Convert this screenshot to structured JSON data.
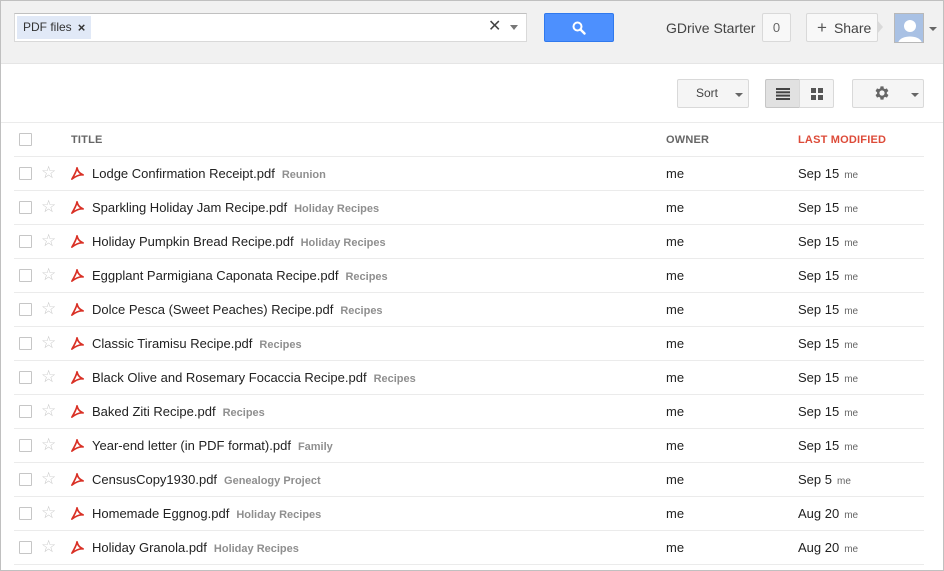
{
  "search": {
    "chip_label": "PDF files",
    "chip_remove": "×",
    "clear": "✕",
    "value": ""
  },
  "account": {
    "name": "GDrive Starter",
    "notifications": "0",
    "share_label": "Share",
    "share_plus": "+"
  },
  "toolbar": {
    "sort_label": "Sort"
  },
  "table": {
    "headers": {
      "title": "TITLE",
      "owner": "OWNER",
      "last_modified": "LAST MODIFIED"
    },
    "rows": [
      {
        "name": "Lodge Confirmation Receipt.pdf",
        "folder": "Reunion",
        "owner": "me",
        "date": "Sep 15",
        "by": "me"
      },
      {
        "name": "Sparkling Holiday Jam Recipe.pdf",
        "folder": "Holiday Recipes",
        "owner": "me",
        "date": "Sep 15",
        "by": "me"
      },
      {
        "name": "Holiday Pumpkin Bread Recipe.pdf",
        "folder": "Holiday Recipes",
        "owner": "me",
        "date": "Sep 15",
        "by": "me"
      },
      {
        "name": "Eggplant Parmigiana Caponata Recipe.pdf",
        "folder": "Recipes",
        "owner": "me",
        "date": "Sep 15",
        "by": "me"
      },
      {
        "name": "Dolce Pesca (Sweet Peaches) Recipe.pdf",
        "folder": "Recipes",
        "owner": "me",
        "date": "Sep 15",
        "by": "me"
      },
      {
        "name": "Classic Tiramisu Recipe.pdf",
        "folder": "Recipes",
        "owner": "me",
        "date": "Sep 15",
        "by": "me"
      },
      {
        "name": "Black Olive and Rosemary Focaccia Recipe.pdf",
        "folder": "Recipes",
        "owner": "me",
        "date": "Sep 15",
        "by": "me"
      },
      {
        "name": "Baked Ziti Recipe.pdf",
        "folder": "Recipes",
        "owner": "me",
        "date": "Sep 15",
        "by": "me"
      },
      {
        "name": "Year-end letter (in PDF format).pdf",
        "folder": "Family",
        "owner": "me",
        "date": "Sep 15",
        "by": "me"
      },
      {
        "name": "CensusCopy1930.pdf",
        "folder": "Genealogy Project",
        "owner": "me",
        "date": "Sep 5",
        "by": "me"
      },
      {
        "name": "Homemade Eggnog.pdf",
        "folder": "Holiday Recipes",
        "owner": "me",
        "date": "Aug 20",
        "by": "me"
      },
      {
        "name": "Holiday Granola.pdf",
        "folder": "Holiday Recipes",
        "owner": "me",
        "date": "Aug 20",
        "by": "me"
      }
    ]
  },
  "icons": {
    "search": "search-icon",
    "star": "star-icon",
    "pdf": "pdf-icon",
    "list_view": "list-view-icon",
    "grid_view": "grid-view-icon",
    "settings": "gear-icon",
    "avatar": "avatar-icon"
  },
  "colors": {
    "accent_blue": "#4d90fe",
    "sort_active_red": "#dd4b39",
    "pdf_red": "#d93025",
    "chip_bg": "#e1e9f7"
  }
}
